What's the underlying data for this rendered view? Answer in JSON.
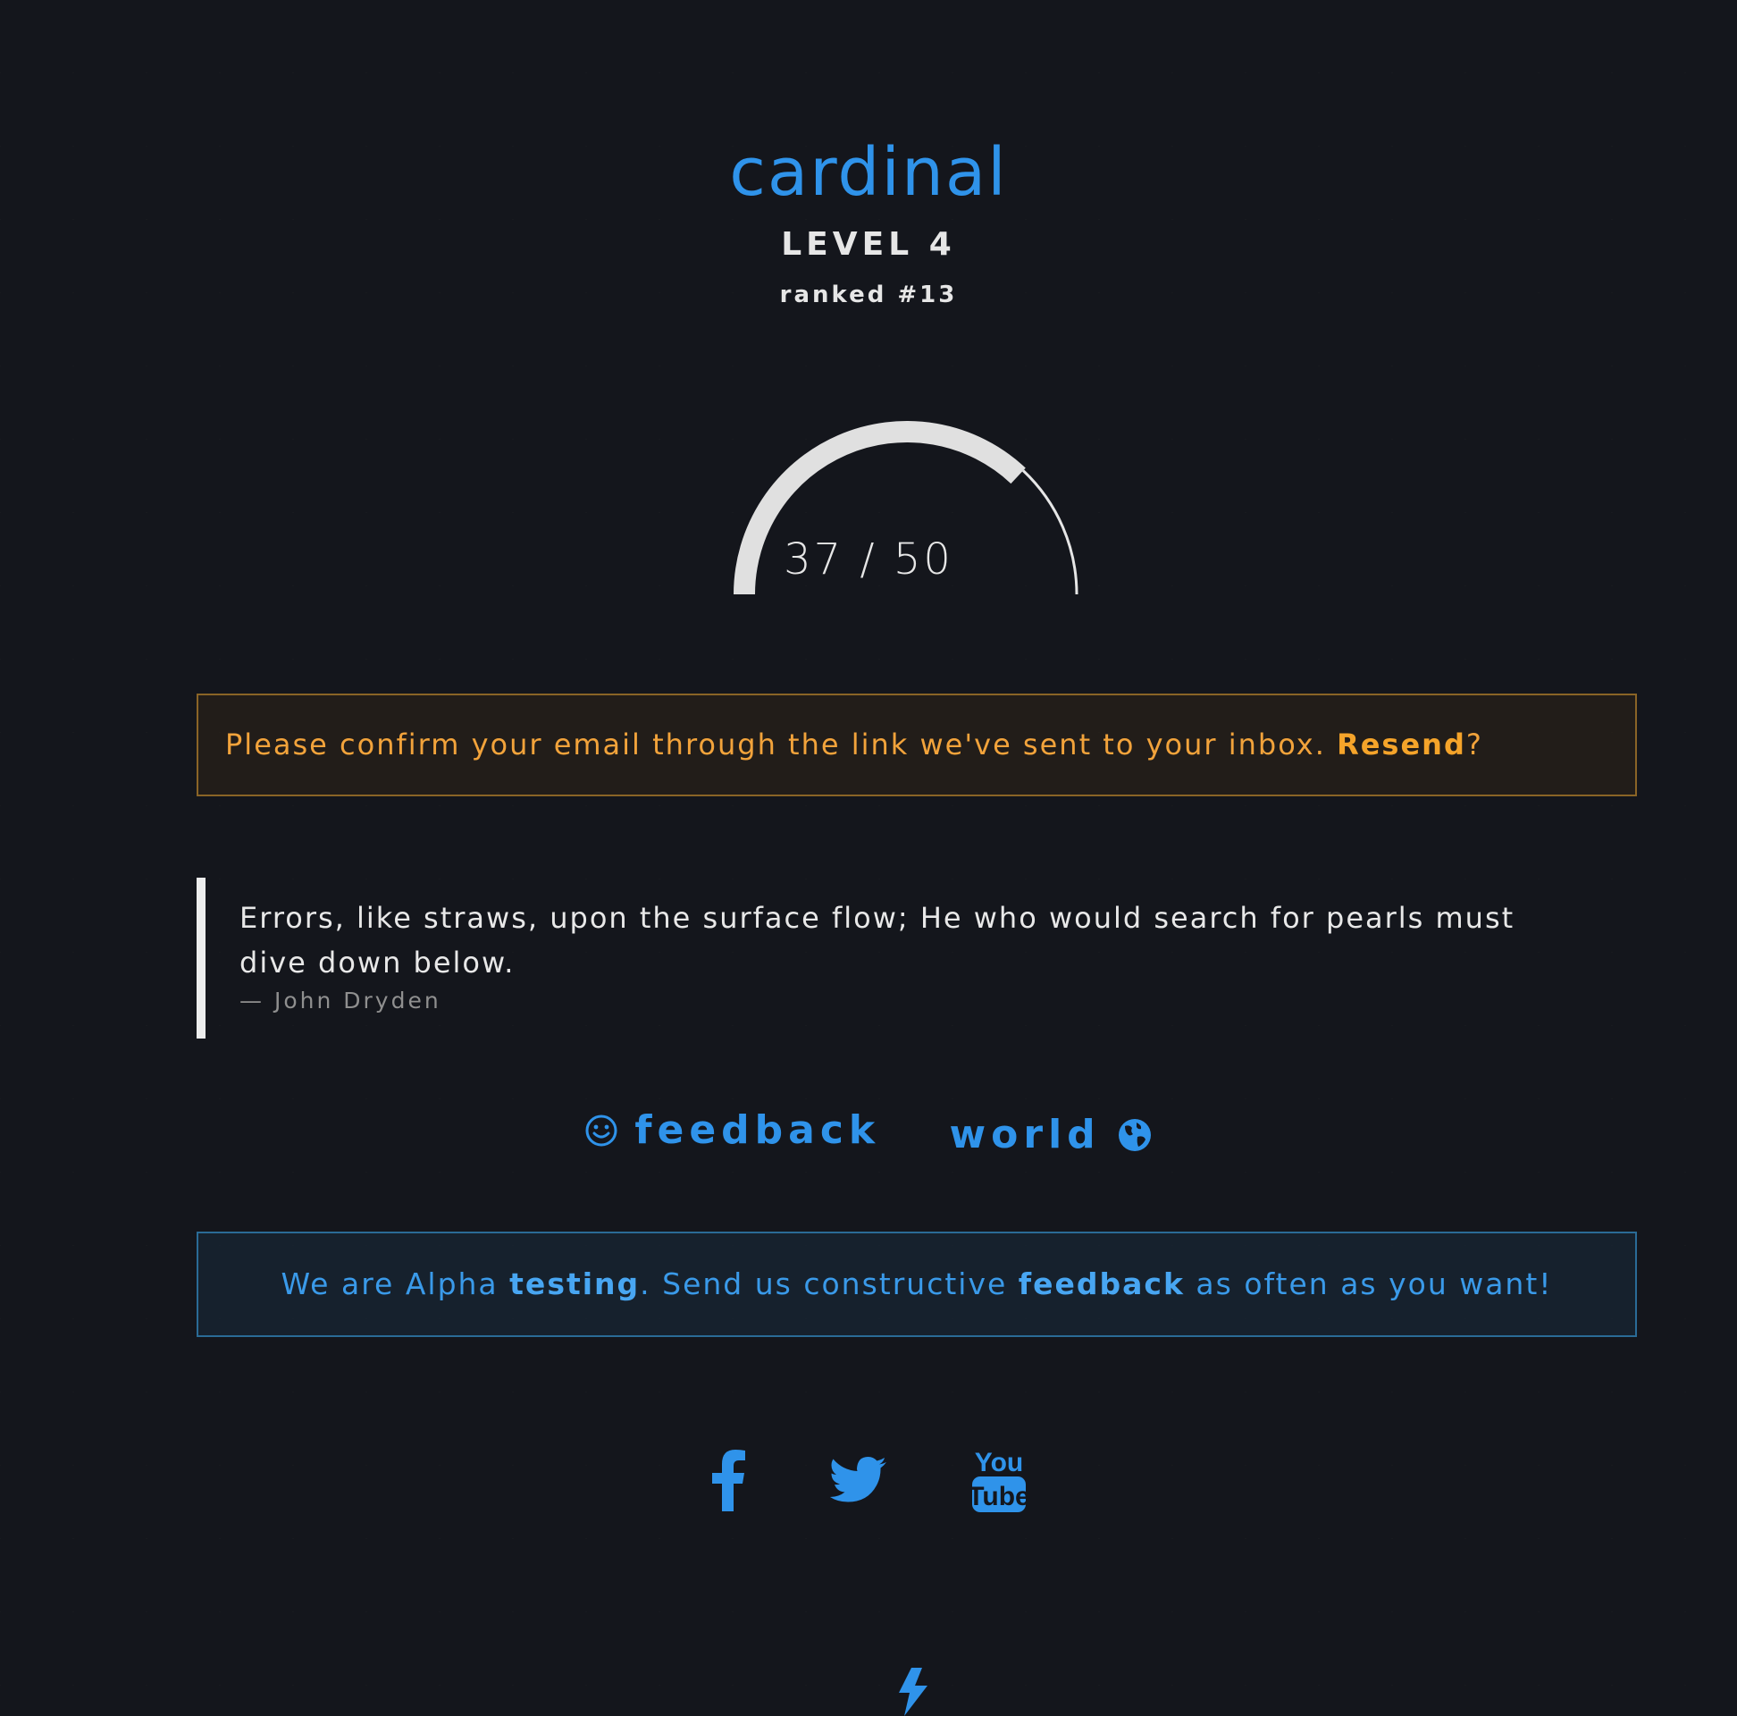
{
  "profile": {
    "username": "cardinal",
    "level": "LEVEL 4",
    "rank": "ranked #13"
  },
  "progress": {
    "label": "37 / 50",
    "current": 37,
    "max": 50,
    "fraction": 0.74
  },
  "email_alert": {
    "message": "Please confirm your email through the link we've sent to your inbox. ",
    "link_label": "Resend",
    "suffix": "?"
  },
  "quote": {
    "text": "Errors, like straws, upon the surface flow; He who would search for pearls must dive down below.",
    "author": "— John Dryden"
  },
  "nav": {
    "feedback": {
      "label": "feedback",
      "icon": "smiley-icon"
    },
    "world": {
      "label": "world",
      "icon": "globe-icon"
    }
  },
  "alpha_alert": {
    "part1": "We are Alpha ",
    "testing": "testing",
    "part2": ". Send us constructive ",
    "feedback": "feedback",
    "part3": " as often as you want!"
  },
  "social": {
    "facebook_icon": "facebook-icon",
    "twitter_icon": "twitter-icon",
    "youtube_icon": "youtube-icon",
    "youtube_text_top": "You",
    "youtube_text_bottom": "Tube"
  },
  "colors": {
    "accent": "#2f93ea",
    "warning": "#f2a33b",
    "background": "#14161c",
    "gauge_filled": "#e0e0e0"
  }
}
